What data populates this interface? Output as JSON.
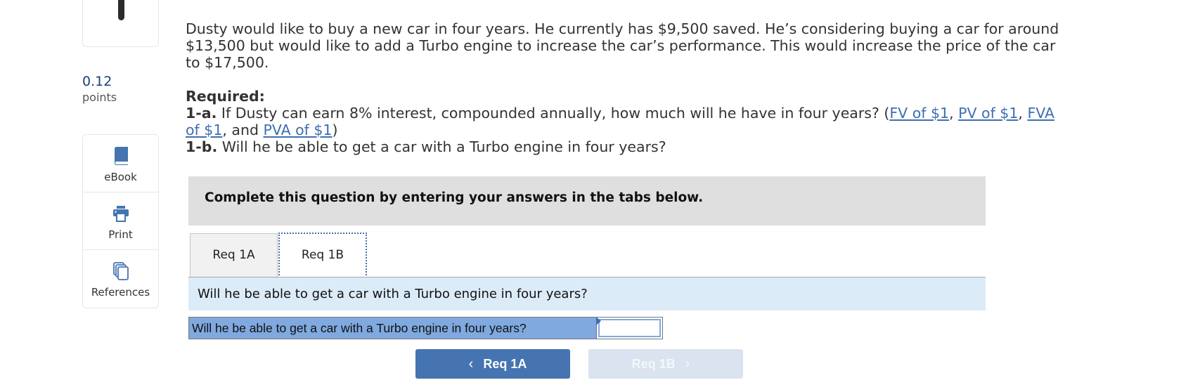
{
  "sidebar": {
    "points_value": "0.12",
    "points_label": "points",
    "tools": [
      {
        "label": "eBook",
        "icon": "book-icon"
      },
      {
        "label": "Print",
        "icon": "printer-icon"
      },
      {
        "label": "References",
        "icon": "documents-icon"
      }
    ]
  },
  "question": {
    "paragraph": "Dusty would like to buy a new car in four years. He currently has $9,500 saved. He’s considering buying a car for around $13,500 but would like to add a Turbo engine to increase the car’s performance. This would increase the price of the car to $17,500.",
    "required_label": "Required:",
    "req_1a_prefix": "1-a.",
    "req_1a_text": " If Dusty can earn 8% interest, compounded annually, how much will he have in four years? (",
    "links": [
      "FV of $1",
      "PV of $1",
      "FVA of $1",
      "PVA of $1"
    ],
    "sep1": ", ",
    "sep2": ", ",
    "sep3": ", and ",
    "close": ")",
    "req_1b_prefix": "1-b.",
    "req_1b_text": " Will he be able to get a car with a Turbo engine in four years?"
  },
  "instruction": "Complete this question by entering your answers in the tabs below.",
  "tabs": [
    {
      "label": "Req 1A",
      "active": false
    },
    {
      "label": "Req 1B",
      "active": true
    }
  ],
  "tab_question": "Will he be able to get a car with a Turbo engine in four years?",
  "answer": {
    "label": "Will he be able to get a car with a Turbo engine in four years?",
    "value": ""
  },
  "nav": {
    "prev_label": "Req 1A",
    "next_label": "Req 1B",
    "next_disabled": true
  },
  "colors": {
    "accent": "#4574b1",
    "link": "#3e6fb0",
    "points": "#1c3f79",
    "answer_label_bg": "#7fa9df",
    "question_band_bg": "#dcebf8",
    "instruction_bg": "#dfdfdf"
  }
}
